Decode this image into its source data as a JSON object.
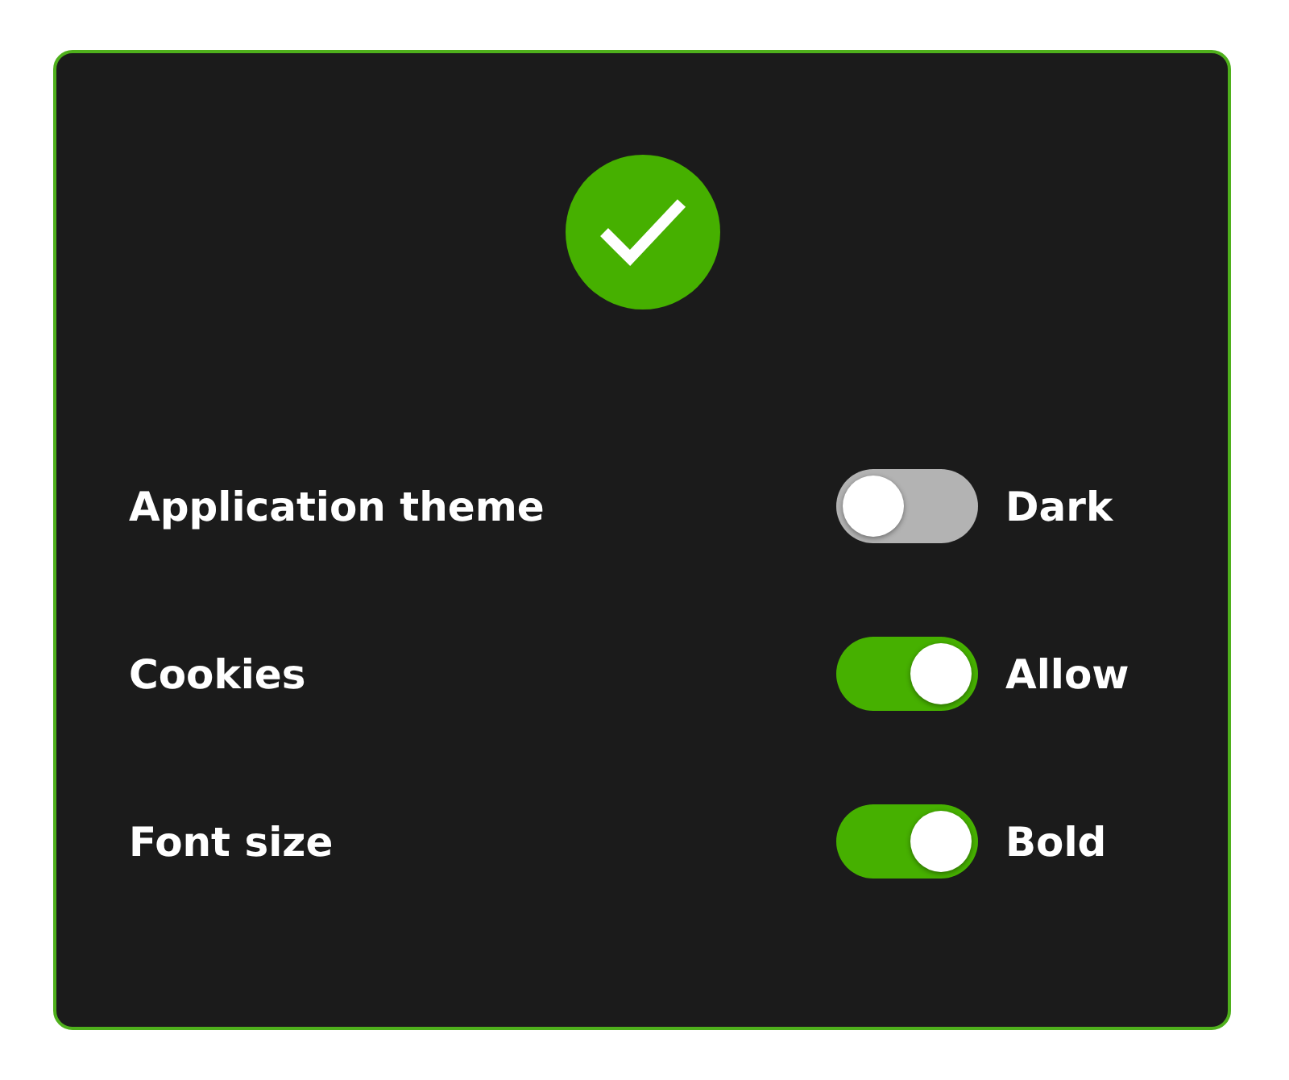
{
  "settings": [
    {
      "label": "Application theme",
      "on": false,
      "value": "Dark"
    },
    {
      "label": "Cookies",
      "on": true,
      "value": "Allow"
    },
    {
      "label": "Font size",
      "on": true,
      "value": "Bold"
    }
  ]
}
